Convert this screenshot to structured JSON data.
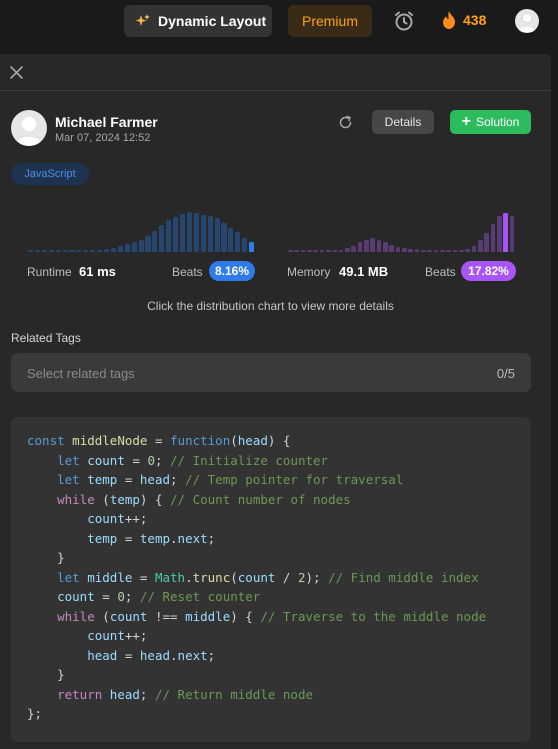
{
  "topnav": {
    "layout_button": "Dynamic Layout",
    "premium_button": "Premium",
    "streak_count": "438",
    "accent": "#ffa116"
  },
  "submission": {
    "user_name": "Michael Farmer",
    "date": "Mar 07, 2024 12:52",
    "details_button": "Details",
    "solution_button": "Solution",
    "language": "JavaScript"
  },
  "runtime": {
    "label": "Runtime",
    "value": "61 ms",
    "beats_label": "Beats",
    "beats_value": "8.16%",
    "color": "#2f7be8",
    "distribution": [
      0.04,
      0.04,
      0.04,
      0.04,
      0.04,
      0.04,
      0.04,
      0.04,
      0.04,
      0.04,
      0.04,
      0.06,
      0.08,
      0.12,
      0.16,
      0.2,
      0.26,
      0.34,
      0.44,
      0.56,
      0.66,
      0.72,
      0.8,
      0.84,
      0.82,
      0.78,
      0.74,
      0.7,
      0.6,
      0.5,
      0.42,
      0.3,
      0.2
    ],
    "highlight_index": 32
  },
  "memory": {
    "label": "Memory",
    "value": "49.1 MB",
    "beats_label": "Beats",
    "beats_value": "17.82%",
    "color": "#a855f7",
    "distribution": [
      0.04,
      0.04,
      0.04,
      0.04,
      0.04,
      0.04,
      0.04,
      0.04,
      0.04,
      0.08,
      0.12,
      0.2,
      0.26,
      0.3,
      0.26,
      0.2,
      0.14,
      0.1,
      0.08,
      0.06,
      0.06,
      0.04,
      0.04,
      0.04,
      0.04,
      0.04,
      0.04,
      0.04,
      0.06,
      0.12,
      0.24,
      0.4,
      0.58,
      0.74,
      0.82,
      0.74
    ],
    "highlight_index": 34
  },
  "hint": "Click the distribution chart to view more details",
  "related_tags": {
    "title": "Related Tags",
    "placeholder": "Select related tags",
    "count": "0/5"
  },
  "code": [
    "const middleNode = function(head) {",
    "    let count = 0; // Initialize counter",
    "    let temp = head; // Temp pointer for traversal",
    "    while (temp) { // Count number of nodes",
    "        count++;",
    "        temp = temp.next;",
    "    }",
    "    let middle = Math.trunc(count / 2); // Find middle index",
    "    count = 0; // Reset counter",
    "    while (count !== middle) { // Traverse to the middle node",
    "        count++;",
    "        head = head.next;",
    "    }",
    "    return head; // Return middle node",
    "};"
  ]
}
